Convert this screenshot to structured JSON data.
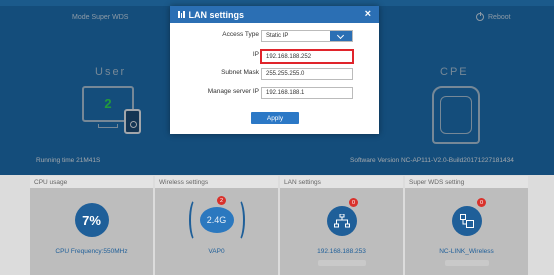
{
  "header": {
    "mode_label": "Mode",
    "mode_value": "Super WDS",
    "reboot_label": "Reboot"
  },
  "topology": {
    "user_label": "User",
    "user_count": "2",
    "cpe_label": "CPE"
  },
  "status": {
    "running_time": "Running time  21M41S",
    "software_version": "Software Version   NC-AP111-V2.0-Build20171227181434"
  },
  "panels": [
    {
      "title": "CPU usage",
      "value": "7%",
      "footer": "CPU Frequency:550MHz"
    },
    {
      "title": "Wireless settings",
      "value": "2.4G",
      "badge": "2",
      "footer": "VAP0"
    },
    {
      "title": "LAN settings",
      "icon": "network-icon",
      "badge": "0",
      "footer": "192.168.188.253"
    },
    {
      "title": "Super WDS setting",
      "icon": "wds-icon",
      "badge": "0",
      "footer": "NC-LINK_Wireless"
    }
  ],
  "modal": {
    "title": "LAN settings",
    "close": "×",
    "fields": {
      "access_type_label": "Access Type",
      "access_type_value": "Static IP",
      "ip_label": "IP",
      "ip_value": "192.168.188.252",
      "subnet_label": "Subnet Mask",
      "subnet_value": "255.255.255.0",
      "gateway_label": "Manage server IP",
      "gateway_value": "192.168.188.1"
    },
    "apply_label": "Apply"
  },
  "colors": {
    "primary": "#2b6fb4",
    "highlight": "#e0242b",
    "badge": "#d9312b",
    "user_count": "#33dd55"
  }
}
